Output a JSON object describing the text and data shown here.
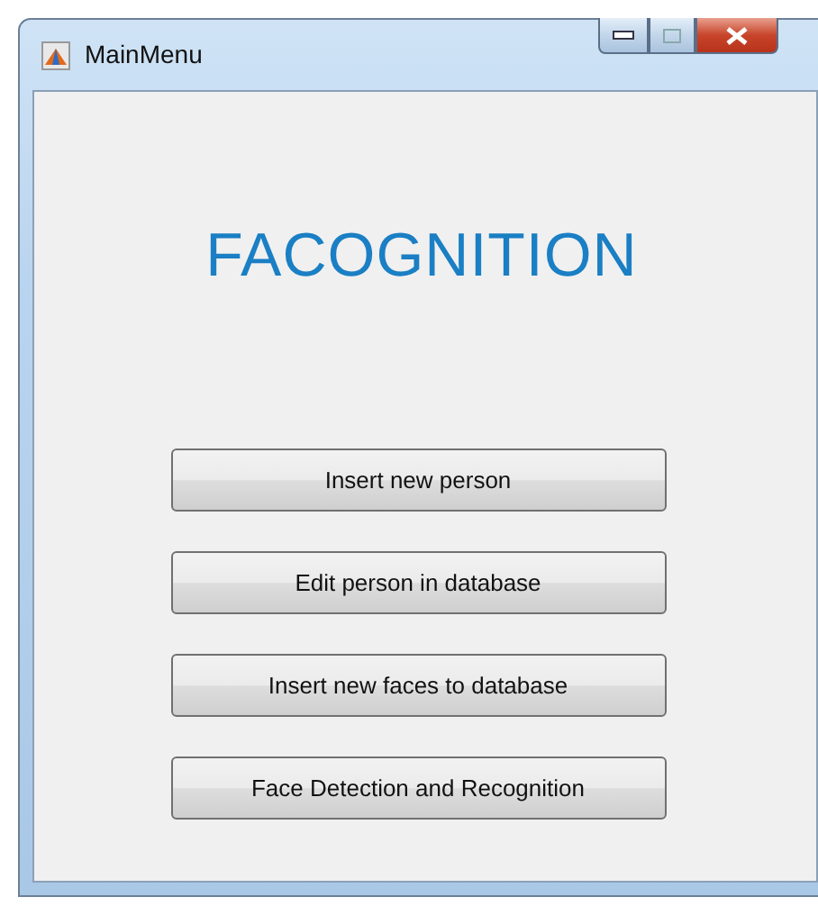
{
  "window": {
    "title": "MainMenu"
  },
  "heading": "FACOGNITION",
  "buttons": [
    {
      "label": "Insert new person"
    },
    {
      "label": "Edit person in database"
    },
    {
      "label": "Insert new faces to database"
    },
    {
      "label": "Face Detection and Recognition"
    }
  ]
}
